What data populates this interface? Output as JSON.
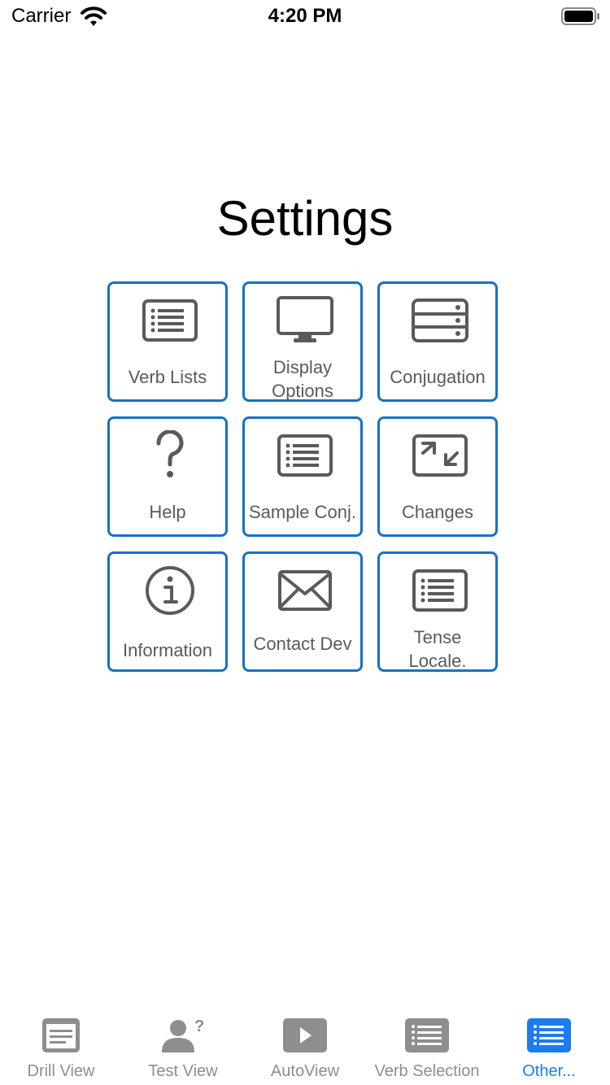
{
  "status_bar": {
    "carrier": "Carrier",
    "time": "4:20 PM"
  },
  "title": "Settings",
  "tiles": [
    {
      "label": "Verb Lists",
      "icon": "list-icon"
    },
    {
      "label": "Display\nOptions",
      "icon": "monitor-icon"
    },
    {
      "label": "Conjugation",
      "icon": "server-stack-icon"
    },
    {
      "label": "Help",
      "icon": "question-mark-icon"
    },
    {
      "label": "Sample Conj.",
      "icon": "list-icon"
    },
    {
      "label": "Changes",
      "icon": "compress-arrows-icon"
    },
    {
      "label": "Information",
      "icon": "info-circle-icon"
    },
    {
      "label": "Contact Dev",
      "icon": "envelope-icon"
    },
    {
      "label": "Tense\nLocale.",
      "icon": "list-icon"
    }
  ],
  "tab_bar": {
    "items": [
      {
        "label": "Drill View",
        "icon": "document-icon",
        "active": false
      },
      {
        "label": "Test View",
        "icon": "person-question-icon",
        "active": false
      },
      {
        "label": "AutoView",
        "icon": "play-icon",
        "active": false
      },
      {
        "label": "Verb Selection",
        "icon": "list-icon",
        "active": false
      },
      {
        "label": "Other...",
        "icon": "list-icon",
        "active": true
      }
    ]
  },
  "colors": {
    "accent": "#1a7cf0",
    "tile_border": "#1472c8",
    "icon_gray": "#5a5a5a",
    "tab_inactive": "#8e8e8e"
  }
}
